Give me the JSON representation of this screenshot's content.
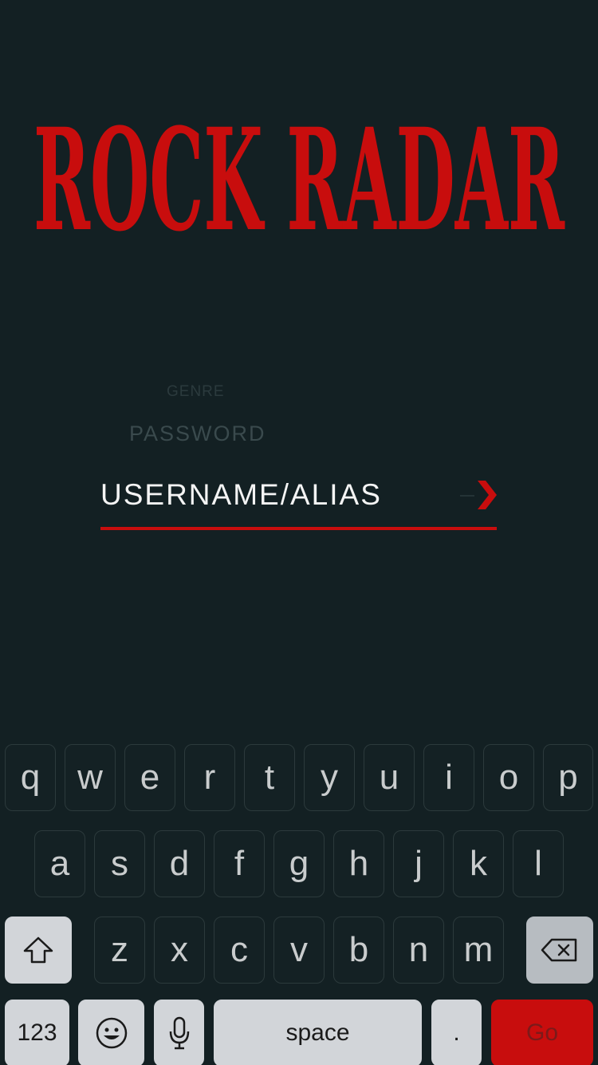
{
  "app": {
    "logo_text": "ROCK RADAR",
    "brand_color": "#c80d0d",
    "background_color": "#132023"
  },
  "form": {
    "genre_label": "GENRE",
    "password_label": "PASSWORD",
    "username_value": "USERNAME/ALIAS",
    "next_icon": "chevron-right-icon"
  },
  "keyboard": {
    "row1": [
      "q",
      "w",
      "e",
      "r",
      "t",
      "y",
      "u",
      "i",
      "o",
      "p"
    ],
    "row2": [
      "a",
      "s",
      "d",
      "f",
      "g",
      "h",
      "j",
      "k",
      "l"
    ],
    "row3": [
      "z",
      "x",
      "c",
      "v",
      "b",
      "n",
      "m"
    ],
    "shift_icon": "shift-arrow-icon",
    "backspace_icon": "backspace-icon",
    "numbers_label": "123",
    "emoji_icon": "emoji-icon",
    "mic_icon": "microphone-icon",
    "space_label": "space",
    "period_label": ".",
    "go_label": "Go"
  }
}
